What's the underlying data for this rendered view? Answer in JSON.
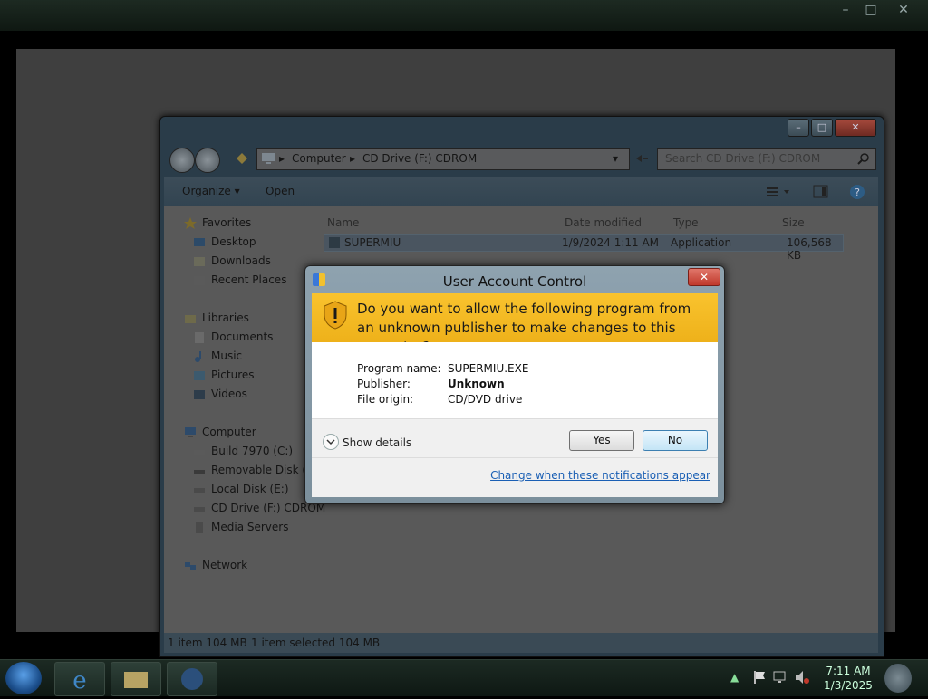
{
  "outer_window": {
    "controls": [
      "–",
      "□",
      "✕"
    ]
  },
  "explorer": {
    "address": {
      "parts": [
        "Computer",
        "CD Drive (F:) CDROM"
      ]
    },
    "search_placeholder": "Search CD Drive (F:) CDROM",
    "toolbar": {
      "organize": "Organize ▾",
      "open": "Open"
    },
    "nav": {
      "favorites": "Favorites",
      "desktop": "Desktop",
      "downloads": "Downloads",
      "recent_places": "Recent Places",
      "libraries": "Libraries",
      "documents": "Documents",
      "music": "Music",
      "pictures": "Pictures",
      "videos": "Videos",
      "computer": "Computer",
      "build": "Build 7970 (C:)",
      "removable": "Removable Disk (D:)",
      "local_disk": "Local Disk (E:)",
      "cd_drive": "CD Drive (F:) CDROM",
      "media_servers": "Media Servers",
      "network": "Network"
    },
    "columns": {
      "name": "Name",
      "date": "Date modified",
      "type": "Type",
      "size": "Size"
    },
    "file": {
      "name": "SUPERMIU",
      "date": "1/9/2024 1:11 AM",
      "type": "Application",
      "size": "106,568 KB"
    },
    "status": {
      "items": "1 item  104 MB",
      "selected": "1 item selected  104 MB"
    }
  },
  "uac": {
    "title": "User Account Control",
    "close": "✕",
    "question": "Do you want to allow the following program from an unknown publisher to make changes to this computer?",
    "program_label": "Program name:",
    "program_value": "SUPERMIU.EXE",
    "publisher_label": "Publisher:",
    "publisher_value": "Unknown",
    "origin_label": "File origin:",
    "origin_value": "CD/DVD drive",
    "show_details": "Show details",
    "yes": "Yes",
    "no": "No",
    "link": "Change when these notifications appear"
  },
  "taskbar": {
    "time": "7:11 AM",
    "date": "1/3/2025"
  }
}
